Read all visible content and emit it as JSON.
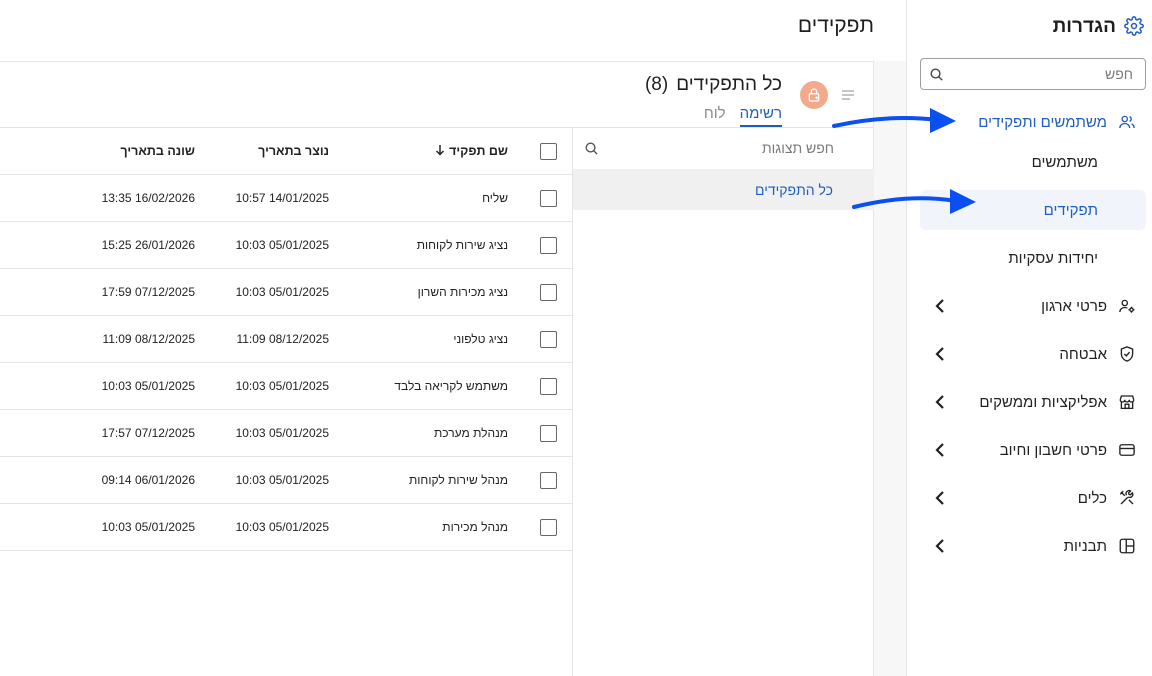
{
  "sidebar": {
    "title": "הגדרות",
    "search_placeholder": "חפש",
    "items": [
      {
        "label": "משתמשים ותפקידים",
        "icon": "users-icon"
      },
      {
        "label": "משתמשים"
      },
      {
        "label": "תפקידים"
      },
      {
        "label": "יחידות עסקיות"
      },
      {
        "label": "פרטי ארגון",
        "icon": "user-cog-icon"
      },
      {
        "label": "אבטחה",
        "icon": "shield-icon"
      },
      {
        "label": "אפליקציות וממשקים",
        "icon": "store-icon"
      },
      {
        "label": "פרטי חשבון וחיוב",
        "icon": "credit-card-icon"
      },
      {
        "label": "כלים",
        "icon": "tools-icon"
      },
      {
        "label": "תבניות",
        "icon": "layout-icon"
      }
    ]
  },
  "page": {
    "title": "תפקידים"
  },
  "panel": {
    "view_title": "כל התפקידים",
    "count": "(8)",
    "tabs": [
      "רשימה",
      "לוח"
    ],
    "views_search_placeholder": "חפש תצוגות",
    "views": [
      "כל התפקידים"
    ]
  },
  "table": {
    "columns": [
      "שם תפקיד",
      "נוצר בתאריך",
      "שונה בתאריך"
    ],
    "rows": [
      {
        "name": "שליח",
        "created": "10:57 14/01/2025",
        "modified": "13:35 16/02/2026"
      },
      {
        "name": "נציג שירות לקוחות",
        "created": "10:03 05/01/2025",
        "modified": "15:25 26/01/2026"
      },
      {
        "name": "נציג מכירות השרון",
        "created": "10:03 05/01/2025",
        "modified": "17:59 07/12/2025"
      },
      {
        "name": "נציג טלפוני",
        "created": "11:09 08/12/2025",
        "modified": "11:09 08/12/2025"
      },
      {
        "name": "משתמש לקריאה בלבד",
        "created": "10:03 05/01/2025",
        "modified": "10:03 05/01/2025"
      },
      {
        "name": "מנהלת מערכת",
        "created": "10:03 05/01/2025",
        "modified": "17:57 07/12/2025"
      },
      {
        "name": "מנהל שירות לקוחות",
        "created": "10:03 05/01/2025",
        "modified": "09:14 06/01/2026"
      },
      {
        "name": "מנהל מכירות",
        "created": "10:03 05/01/2025",
        "modified": "10:03 05/01/2025"
      }
    ]
  },
  "colors": {
    "accent": "#1f5dbe",
    "annotation_arrow": "#0a4ff0",
    "avatar": "#f4a98a"
  }
}
